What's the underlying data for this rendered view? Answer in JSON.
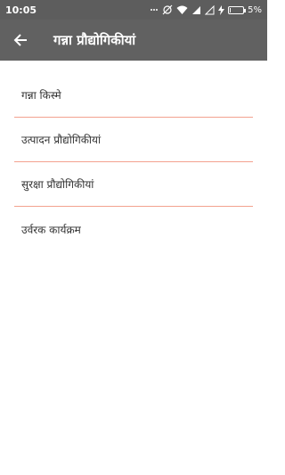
{
  "status_bar": {
    "time": "10:05",
    "battery_percent": "5%",
    "battery_level": 0.05,
    "icons": [
      "dots-icon",
      "sync-off-icon",
      "wifi-icon",
      "signal-icon",
      "no-sim-icon",
      "charging-icon",
      "battery-icon"
    ]
  },
  "app_bar": {
    "title": "गन्ना प्रौद्योगिकीयां",
    "back_icon": "arrow-back-icon"
  },
  "menu": {
    "items": [
      {
        "label": "गन्ना किस्मे"
      },
      {
        "label": "उत्पादन प्रौद्योगिकीयां"
      },
      {
        "label": "सुरक्षा प्रौद्योगिकीयां"
      },
      {
        "label": "उर्वरक कार्यक्रम"
      }
    ]
  },
  "colors": {
    "app_bar": "#616161",
    "status_bar": "#5d5d5d",
    "divider": "#f3a28f",
    "text": "#333333"
  }
}
